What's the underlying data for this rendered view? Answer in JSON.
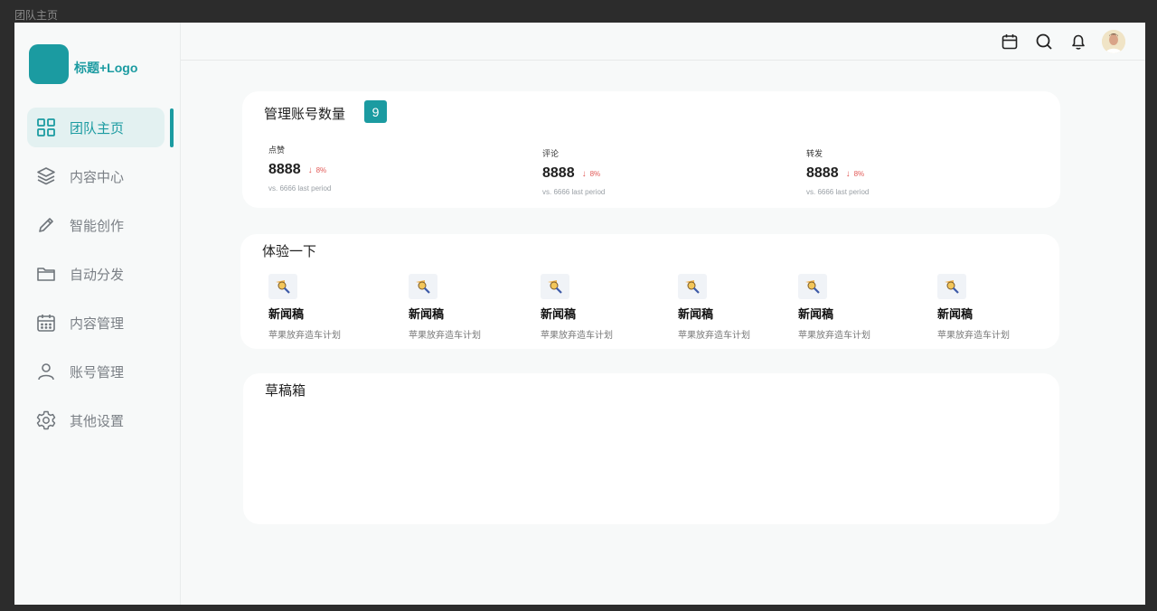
{
  "window": {
    "title": "团队主页"
  },
  "brand": {
    "title": "标题+Logo",
    "color": "#1b9ba1"
  },
  "sidebar": {
    "items": [
      {
        "label": "团队主页",
        "icon": "grid-icon",
        "active": true
      },
      {
        "label": "内容中心",
        "icon": "layers-icon"
      },
      {
        "label": "智能创作",
        "icon": "pencil-icon"
      },
      {
        "label": "自动分发",
        "icon": "folder-icon"
      },
      {
        "label": "内容管理",
        "icon": "calendar-grid-icon"
      },
      {
        "label": "账号管理",
        "icon": "user-icon"
      },
      {
        "label": "其他设置",
        "icon": "gear-icon"
      }
    ]
  },
  "header": {
    "icons": [
      "calendar-icon",
      "search-icon",
      "bell-icon",
      "avatar"
    ]
  },
  "accounts": {
    "title": "管理账号数量",
    "count": "9",
    "stats": [
      {
        "label": "点赞",
        "value": "8888",
        "change": "8%",
        "direction": "down",
        "compare": "vs. 6666 last period"
      },
      {
        "label": "评论",
        "value": "8888",
        "change": "8%",
        "direction": "down",
        "compare": "vs. 6666 last period"
      },
      {
        "label": "转发",
        "value": "8888",
        "change": "8%",
        "direction": "down",
        "compare": "vs. 6666 last period"
      }
    ]
  },
  "experience": {
    "title": "体验一下",
    "tiles": [
      {
        "title": "新闻稿",
        "desc": "苹果放弃造车计划",
        "icon": "magnifier-icon"
      },
      {
        "title": "新闻稿",
        "desc": "苹果放弃造车计划",
        "icon": "magnifier-icon"
      },
      {
        "title": "新闻稿",
        "desc": "苹果放弃造车计划",
        "icon": "magnifier-icon"
      },
      {
        "title": "新闻稿",
        "desc": "苹果放弃造车计划",
        "icon": "magnifier-icon"
      },
      {
        "title": "新闻稿",
        "desc": "苹果放弃造车计划",
        "icon": "magnifier-icon"
      },
      {
        "title": "新闻稿",
        "desc": "苹果放弃造车计划",
        "icon": "magnifier-icon"
      }
    ]
  },
  "drafts": {
    "title": "草稿箱"
  },
  "colors": {
    "accent": "#1b9ba1",
    "negative": "#e25a57"
  }
}
